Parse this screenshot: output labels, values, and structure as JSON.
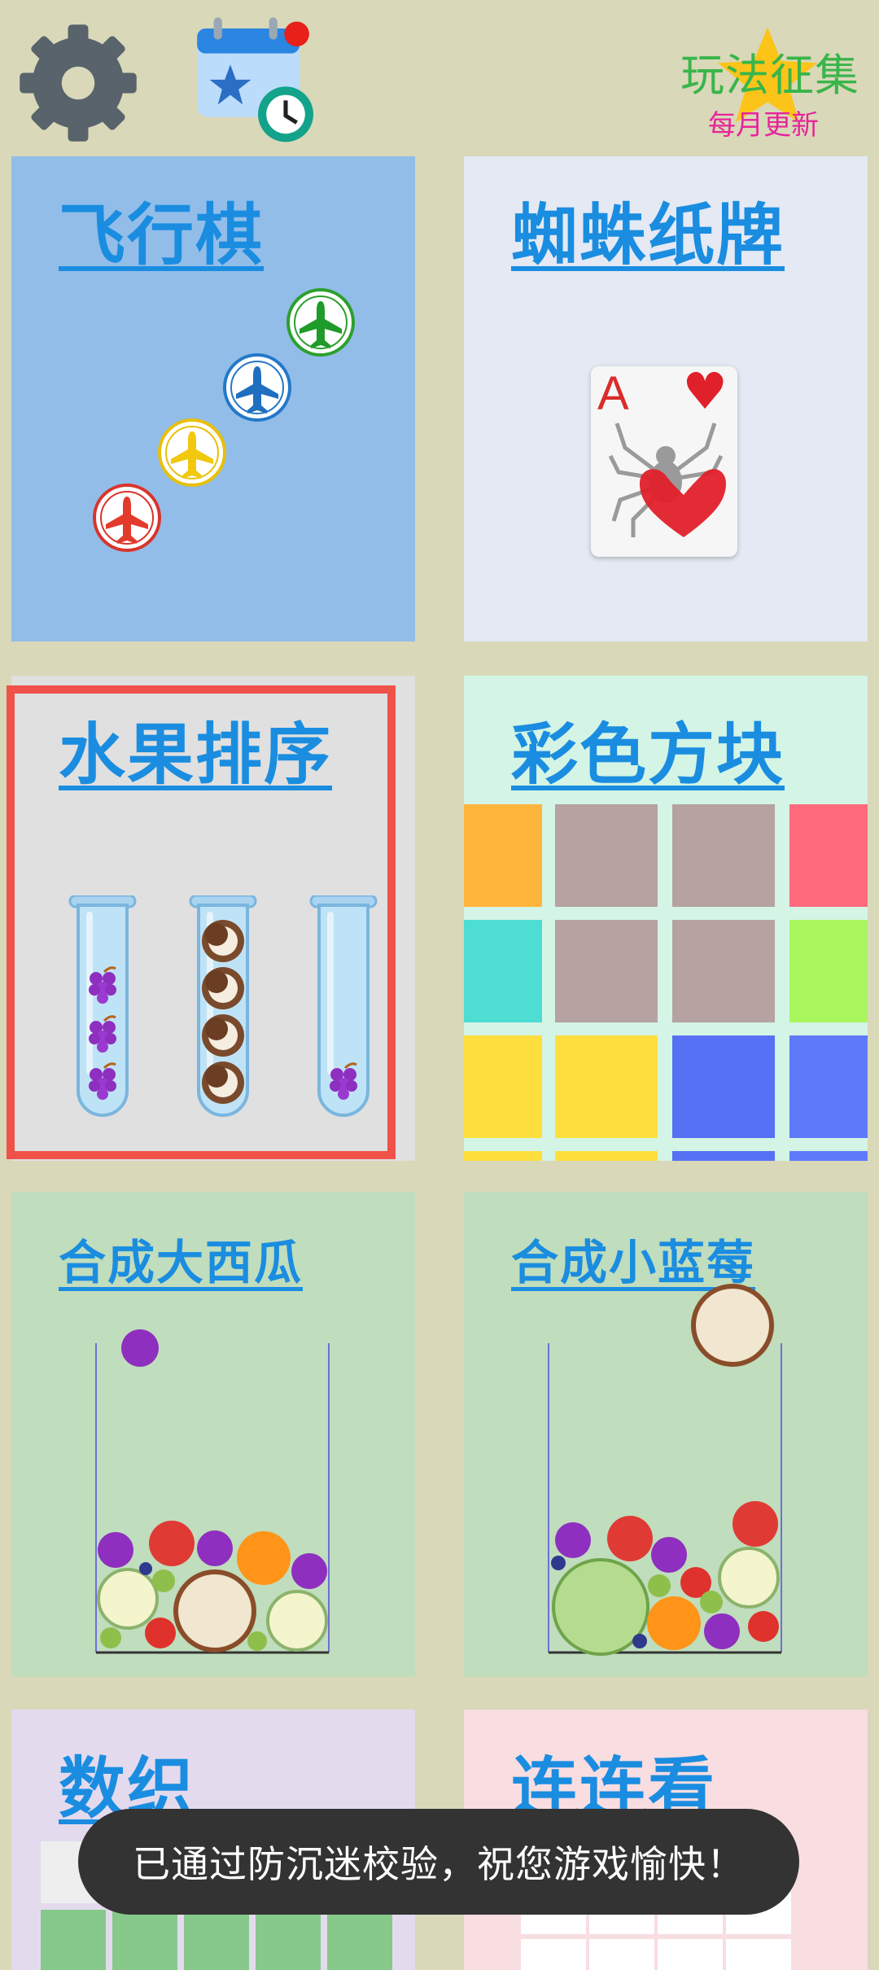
{
  "header": {
    "settings_icon": "gear-icon",
    "calendar_icon": "calendar-clock-icon",
    "promo_title": "玩法征集",
    "promo_subtitle": "每月更新"
  },
  "games": [
    {
      "title": "飞行棋",
      "bg": "#92bde9"
    },
    {
      "title": "蜘蛛纸牌",
      "bg": "#e4e9f4"
    },
    {
      "title": "水果排序",
      "bg": "#e0e0e0",
      "selected": true
    },
    {
      "title": "彩色方块",
      "bg": "#d4f4e5"
    },
    {
      "title": "合成大西瓜",
      "bg": "#c0ddbd"
    },
    {
      "title": "合成小蓝莓",
      "bg": "#c0ddbd"
    },
    {
      "title": "数织",
      "bg": "#e4daee"
    },
    {
      "title": "连连看",
      "bg": "#f8dde1"
    }
  ],
  "card": {
    "rank": "A",
    "suit": "♥"
  },
  "colors": {
    "accent": "#1a8de0",
    "selection": "#ef5248"
  },
  "toast": "已通过防沉迷校验，祝您游戏愉快！"
}
